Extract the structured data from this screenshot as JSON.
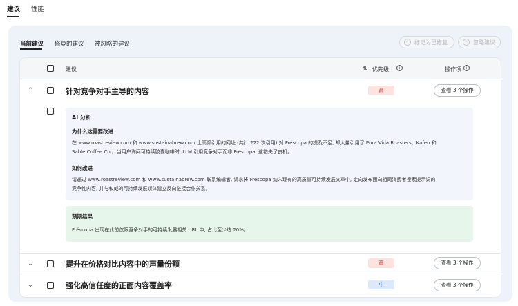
{
  "top_tabs": [
    {
      "label": "建议",
      "active": true
    },
    {
      "label": "性能",
      "active": false
    }
  ],
  "sub_tabs": [
    {
      "label": "当前建议",
      "active": true
    },
    {
      "label": "修复的建议",
      "active": false
    },
    {
      "label": "被忽略的建议",
      "active": false
    }
  ],
  "toolbar": {
    "mark_fixed_label": "标记为已修复",
    "ignore_label": "忽略建议"
  },
  "table": {
    "col_suggestion": "建议",
    "col_priority": "优先级",
    "col_actions": "操作项"
  },
  "rows": [
    {
      "title": "针对竞争对手主导的内容",
      "priority": "高",
      "priority_level": "high",
      "action_label": "查看 3 个操作",
      "expanded": true,
      "detail": {
        "ai_title": "AI 分析",
        "why_heading": "为什么这需要改进",
        "why_text_1": "在 www.roastreview.com 和 www.sustainabrew.com 上高频引用的网址 (共计 222 次引用) 对 Fréscopa 的提及不足, 却大量引用了 Pura Vida Roasters、Kafeo 和",
        "why_text_2": "Sable Coffee Co.。当用户询问可持续胶囊咖啡时, LLM 引用竞争对手而非 Fréscopa, 这错失了良机。",
        "how_heading": "如何改进",
        "how_text_1": "请通过 www.roastreview.com 和 www.sustainabrew.com 联系编辑者, 请求将 Fréscopa 纳入现有的高质量可持续发展文章中, 定向发布面向相同消费者搜索提示词的",
        "how_text_2": "竞争性内容, 并与权威的可持续发展媒体建立反向链接合作关系。",
        "expected_heading": "预期结果",
        "expected_text": "Fréscopa 出现在此前仅限竞争对手的可持续发展相关 URL 中, 占比至少达 20%。"
      }
    },
    {
      "title": "提升在价格对比内容中的声量份额",
      "priority": "高",
      "priority_level": "high",
      "action_label": "查看 3 个操作",
      "expanded": false
    },
    {
      "title": "强化高信任度的正面内容覆盖率",
      "priority": "中",
      "priority_level": "medium",
      "action_label": "查看 3 个操作",
      "expanded": false
    }
  ],
  "colors": {
    "panel_bg": "#eef3fa",
    "badge_high_bg": "#fde3e0",
    "badge_mid_bg": "#dbe9fb",
    "expected_bg": "#e6f6ea"
  }
}
